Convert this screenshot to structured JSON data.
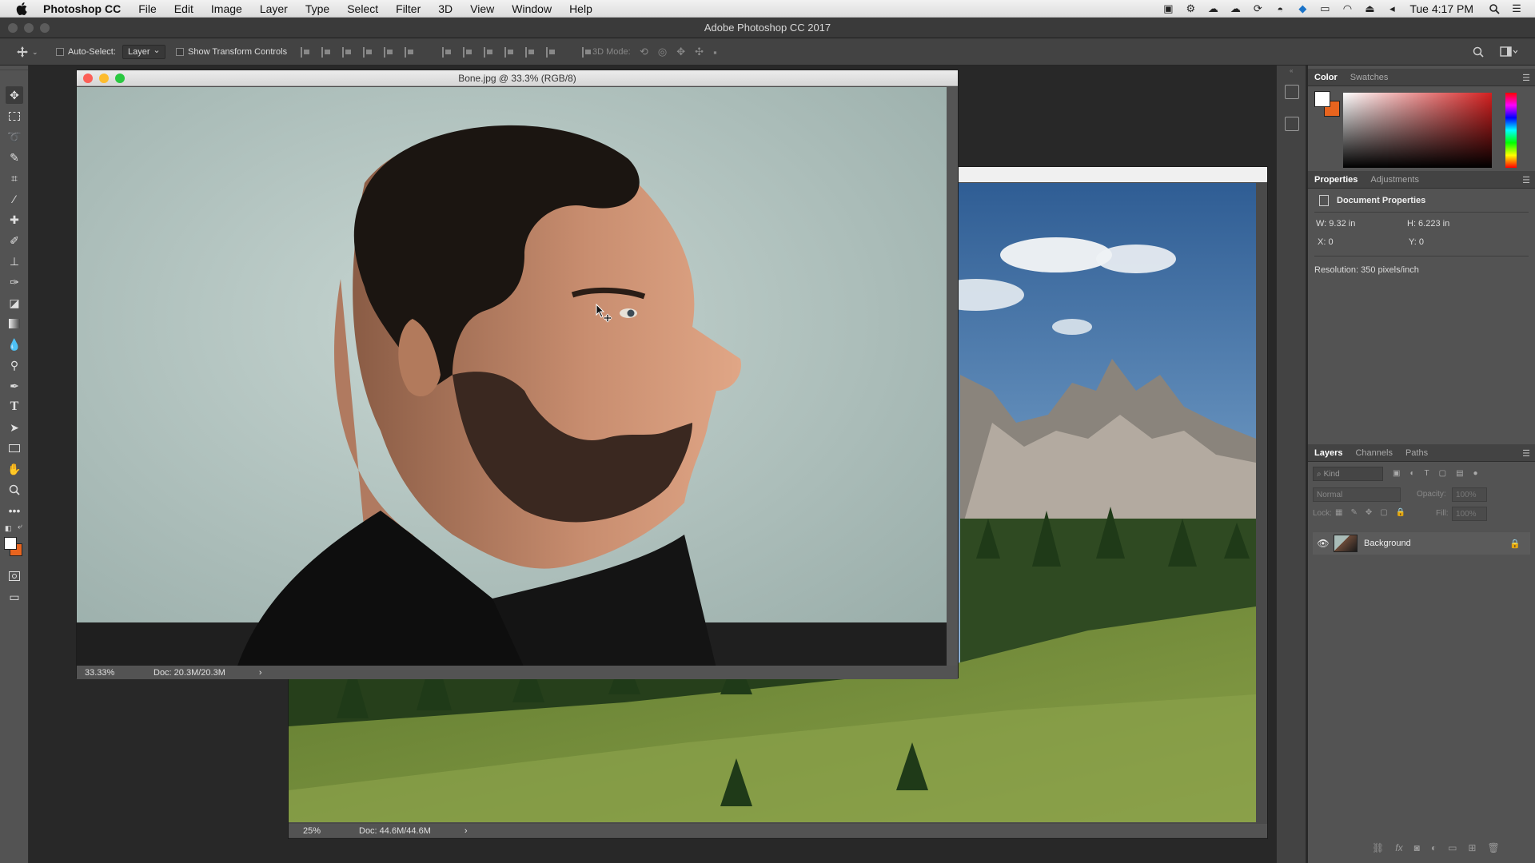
{
  "menubar": {
    "app_name": "Photoshop CC",
    "items": [
      "File",
      "Edit",
      "Image",
      "Layer",
      "Type",
      "Select",
      "Filter",
      "3D",
      "View",
      "Window",
      "Help"
    ],
    "clock": "Tue 4:17 PM"
  },
  "app_title": "Adobe Photoshop CC 2017",
  "options_bar": {
    "auto_select_label": "Auto-Select:",
    "auto_select_value": "Layer",
    "show_transform_label": "Show Transform Controls",
    "mode_3d_label": "3D Mode:"
  },
  "front_doc": {
    "title": "Bone.jpg @ 33.3% (RGB/8)",
    "zoom": "33.33%",
    "doc_size": "Doc: 20.3M/20.3M"
  },
  "back_doc": {
    "zoom": "25%",
    "doc_size": "Doc: 44.6M/44.6M"
  },
  "color_panel": {
    "tabs": [
      "Color",
      "Swatches"
    ],
    "foreground": "#ffffff",
    "background": "#e8641e",
    "hue_color": "#d42020"
  },
  "properties_panel": {
    "tabs": [
      "Properties",
      "Adjustments"
    ],
    "heading": "Document Properties",
    "w": "W:  9.32 in",
    "h": "H:  6.223 in",
    "x": "X:  0",
    "y": "Y:  0",
    "resolution": "Resolution: 350 pixels/inch"
  },
  "layers_panel": {
    "tabs": [
      "Layers",
      "Channels",
      "Paths"
    ],
    "kind_placeholder": "Kind",
    "blend_mode": "Normal",
    "opacity_label": "Opacity:",
    "opacity_value": "100%",
    "lock_label": "Lock:",
    "fill_label": "Fill:",
    "fill_value": "100%",
    "layers": [
      {
        "name": "Background",
        "visible": true,
        "locked": true
      }
    ]
  }
}
